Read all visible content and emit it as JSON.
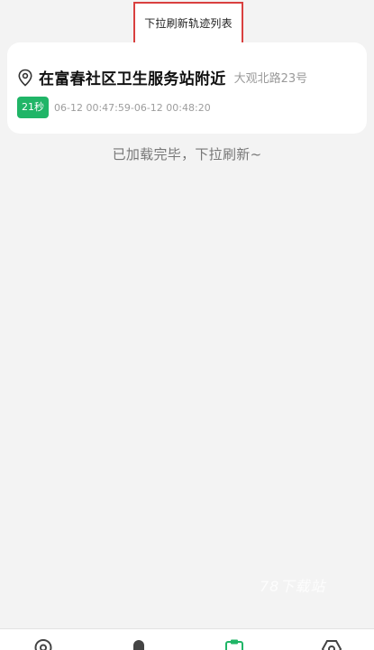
{
  "tooltip": {
    "text": "下拉刷新轨迹列表"
  },
  "track_item": {
    "location_title": "在富春社区卫生服务站附近",
    "location_subtitle": "大观北路23号",
    "duration": "21秒",
    "time_range": "06-12 00:47:59-06-12 00:48:20"
  },
  "status": {
    "loaded_text": "已加载完毕，下拉刷新~"
  },
  "watermark": {
    "text": "78下载站"
  },
  "bottom_nav": {
    "items": [
      {
        "icon": "location-pin-icon"
      },
      {
        "icon": "person-icon"
      },
      {
        "icon": "clipboard-icon"
      },
      {
        "icon": "shield-icon"
      }
    ]
  },
  "colors": {
    "accent_green": "#20b567",
    "tooltip_border": "#d9403f",
    "background": "#f3f3f3"
  }
}
